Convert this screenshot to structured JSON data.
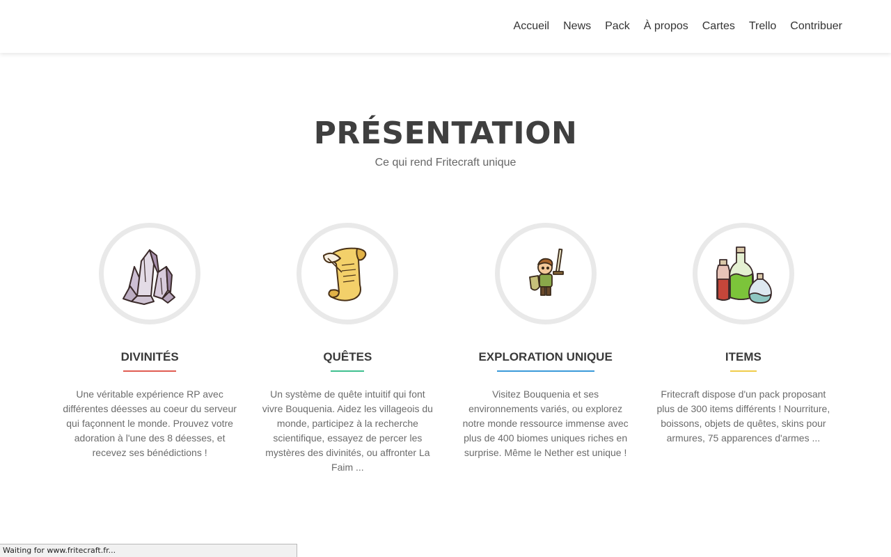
{
  "nav": {
    "items": [
      "Accueil",
      "News",
      "Pack",
      "À propos",
      "Cartes",
      "Trello",
      "Contribuer"
    ]
  },
  "section": {
    "title": "PRÉSENTATION",
    "subtitle": "Ce qui rend Fritecraft unique"
  },
  "features": [
    {
      "title": "DIVINITÉS",
      "icon": "crystal-icon",
      "accent": "#e05c52",
      "description": "Une véritable expérience RP avec différentes déesses au coeur du serveur qui façonnent le monde. Prouvez votre adoration à l'une des 8 déesses, et recevez ses bénédictions !"
    },
    {
      "title": "QUÊTES",
      "icon": "scroll-quill-icon",
      "accent": "#3fbf8f",
      "description": "Un système de quête intuitif qui font vivre Bouquenia. Aidez les villageois du monde, participez à la recherche scientifique, essayez de percer les mystères des divinités, ou affronter La Faim ..."
    },
    {
      "title": "EXPLORATION UNIQUE",
      "icon": "adventurer-icon",
      "accent": "#3a9ad9",
      "description": "Visitez Bouquenia et ses environnements variés, ou explorez notre monde ressource immense avec plus de 400 biomes uniques riches en surprise. Même le Nether est unique !"
    },
    {
      "title": "ITEMS",
      "icon": "potions-icon",
      "accent": "#f0cc4a",
      "description": "Fritecraft dispose d'un pack proposant plus de 300 items différents ! Nourriture, boissons, objets de quêtes, skins pour armures, 75 apparences d'armes ..."
    }
  ],
  "status": {
    "text": "Waiting for www.fritecraft.fr..."
  }
}
